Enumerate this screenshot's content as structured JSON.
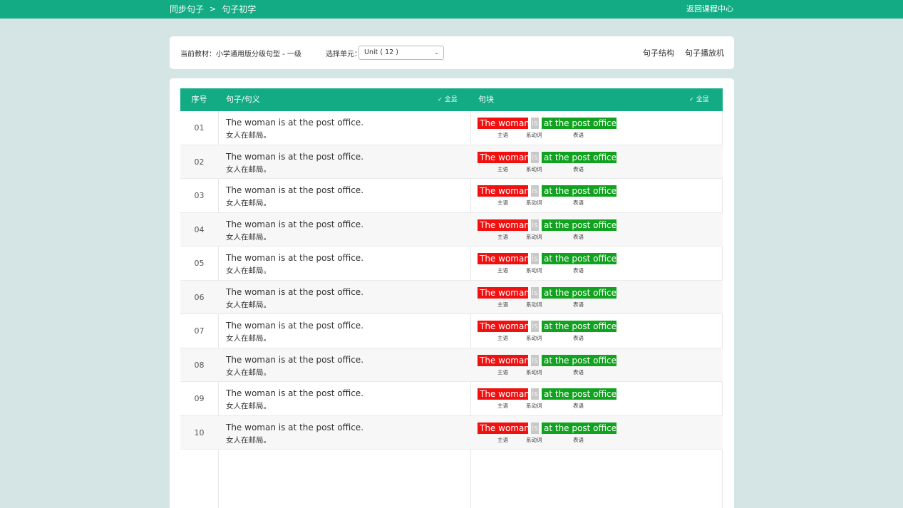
{
  "topbar": {
    "crumb_root": "同步句子",
    "crumb_sep": ">",
    "crumb_current": "句子初学",
    "back_link": "返回课程中心"
  },
  "filter": {
    "textbook_label": "当前教材：",
    "textbook_value": "小学通用版分级句型 - 一级",
    "unit_label": "选择单元：",
    "unit_value": "Unit ( 12 )",
    "structure_link": "句子结构",
    "player_link": "句子播放机"
  },
  "table": {
    "headers": {
      "seq": "序号",
      "sentence": "句子/句义",
      "chunk": "句块",
      "show_all": "全显"
    },
    "rows": [
      {
        "seq": "01",
        "en": "The woman is at the post office.",
        "zh": "女人在邮局。",
        "subject": "The woman",
        "verb": "is",
        "predicate": "at the post office.",
        "subject_tag": "主语",
        "verb_tag": "系动词",
        "predicate_tag": "表语"
      },
      {
        "seq": "02",
        "en": "The woman is at the post office.",
        "zh": "女人在邮局。",
        "subject": "The woman",
        "verb": "is",
        "predicate": "at the post office.",
        "subject_tag": "主语",
        "verb_tag": "系动词",
        "predicate_tag": "表语"
      },
      {
        "seq": "03",
        "en": "The woman is at the post office.",
        "zh": "女人在邮局。",
        "subject": "The woman",
        "verb": "is",
        "predicate": "at the post office.",
        "subject_tag": "主语",
        "verb_tag": "系动词",
        "predicate_tag": "表语"
      },
      {
        "seq": "04",
        "en": "The woman is at the post office.",
        "zh": "女人在邮局。",
        "subject": "The woman",
        "verb": "is",
        "predicate": "at the post office.",
        "subject_tag": "主语",
        "verb_tag": "系动词",
        "predicate_tag": "表语"
      },
      {
        "seq": "05",
        "en": "The woman is at the post office.",
        "zh": "女人在邮局。",
        "subject": "The woman",
        "verb": "is",
        "predicate": "at the post office.",
        "subject_tag": "主语",
        "verb_tag": "系动词",
        "predicate_tag": "表语"
      },
      {
        "seq": "06",
        "en": "The woman is at the post office.",
        "zh": "女人在邮局。",
        "subject": "The woman",
        "verb": "is",
        "predicate": "at the post office.",
        "subject_tag": "主语",
        "verb_tag": "系动词",
        "predicate_tag": "表语"
      },
      {
        "seq": "07",
        "en": "The woman is at the post office.",
        "zh": "女人在邮局。",
        "subject": "The woman",
        "verb": "is",
        "predicate": "at the post office.",
        "subject_tag": "主语",
        "verb_tag": "系动词",
        "predicate_tag": "表语"
      },
      {
        "seq": "08",
        "en": "The woman is at the post office.",
        "zh": "女人在邮局。",
        "subject": "The woman",
        "verb": "is",
        "predicate": "at the post office.",
        "subject_tag": "主语",
        "verb_tag": "系动词",
        "predicate_tag": "表语"
      },
      {
        "seq": "09",
        "en": "The woman is at the post office.",
        "zh": "女人在邮局。",
        "subject": "The woman",
        "verb": "is",
        "predicate": "at the post office.",
        "subject_tag": "主语",
        "verb_tag": "系动词",
        "predicate_tag": "表语"
      },
      {
        "seq": "10",
        "en": "The woman is at the post office.",
        "zh": "女人在邮局。",
        "subject": "The woman",
        "verb": "is",
        "predicate": "at the post office.",
        "subject_tag": "主语",
        "verb_tag": "系动词",
        "predicate_tag": "表语"
      }
    ]
  },
  "colors": {
    "brand": "#12ab84",
    "background": "#d5e5e5",
    "subject": "#f01010",
    "verb": "#c8c8c8",
    "predicate": "#11a21f"
  },
  "icons": {
    "dropdown": "chevron-down-icon",
    "show_all": "check-icon"
  }
}
